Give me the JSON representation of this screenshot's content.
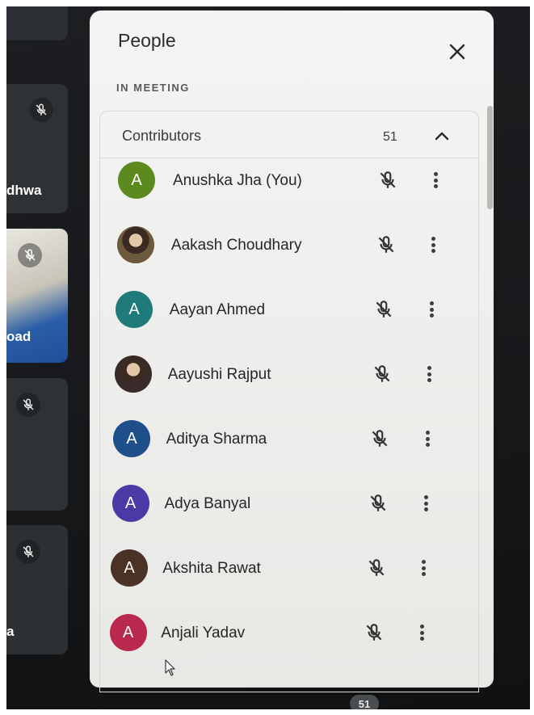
{
  "panel": {
    "title": "People",
    "section_label": "IN MEETING",
    "group": {
      "title": "Contributors",
      "count": "51"
    }
  },
  "participants": [
    {
      "name": "Anushka Jha (You)",
      "initial": "A",
      "avatar_color": "#5c8a1e",
      "photo": false
    },
    {
      "name": "Aakash Choudhary",
      "initial": "",
      "avatar_color": "#6b5a3c",
      "photo": true
    },
    {
      "name": "Aayan Ahmed",
      "initial": "A",
      "avatar_color": "#1f7a7a",
      "photo": false
    },
    {
      "name": "Aayushi Rajput",
      "initial": "",
      "avatar_color": "#3a2b2b",
      "photo": true
    },
    {
      "name": "Aditya Sharma",
      "initial": "A",
      "avatar_color": "#1f4f8a",
      "photo": false
    },
    {
      "name": "Adya Banyal",
      "initial": "A",
      "avatar_color": "#4b3aa6",
      "photo": false
    },
    {
      "name": "Akshita Rawat",
      "initial": "A",
      "avatar_color": "#4a3326",
      "photo": false
    },
    {
      "name": "Anjali Yadav",
      "initial": "A",
      "avatar_color": "#b8294d",
      "photo": false
    }
  ],
  "background_tiles": [
    {
      "name": "dhwa"
    },
    {
      "name": "oad"
    },
    {
      "name": "a"
    }
  ],
  "bottom_bar": {
    "participant_count": "51"
  },
  "icons": {
    "close": "close-icon",
    "chevron": "chevron-up-icon",
    "mute": "mic-off-icon",
    "more": "more-vert-icon"
  }
}
